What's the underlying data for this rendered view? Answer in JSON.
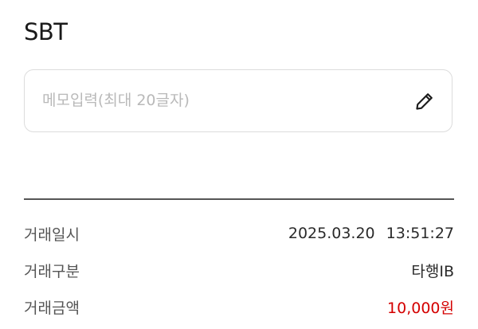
{
  "header": {
    "title": "SBT"
  },
  "memo": {
    "placeholder": "메모입력(최대 20글자)",
    "value": ""
  },
  "icons": {
    "edit": "pencil-icon"
  },
  "details": {
    "rows": [
      {
        "label": "거래일시",
        "date": "2025.03.20",
        "time": "13:51:27"
      },
      {
        "label": "거래구분",
        "value": "타행IB"
      },
      {
        "label": "거래금액",
        "value": "10,000원"
      }
    ]
  },
  "colors": {
    "amount": "#d40000",
    "border": "#dcdcdc",
    "divider": "#555555"
  }
}
